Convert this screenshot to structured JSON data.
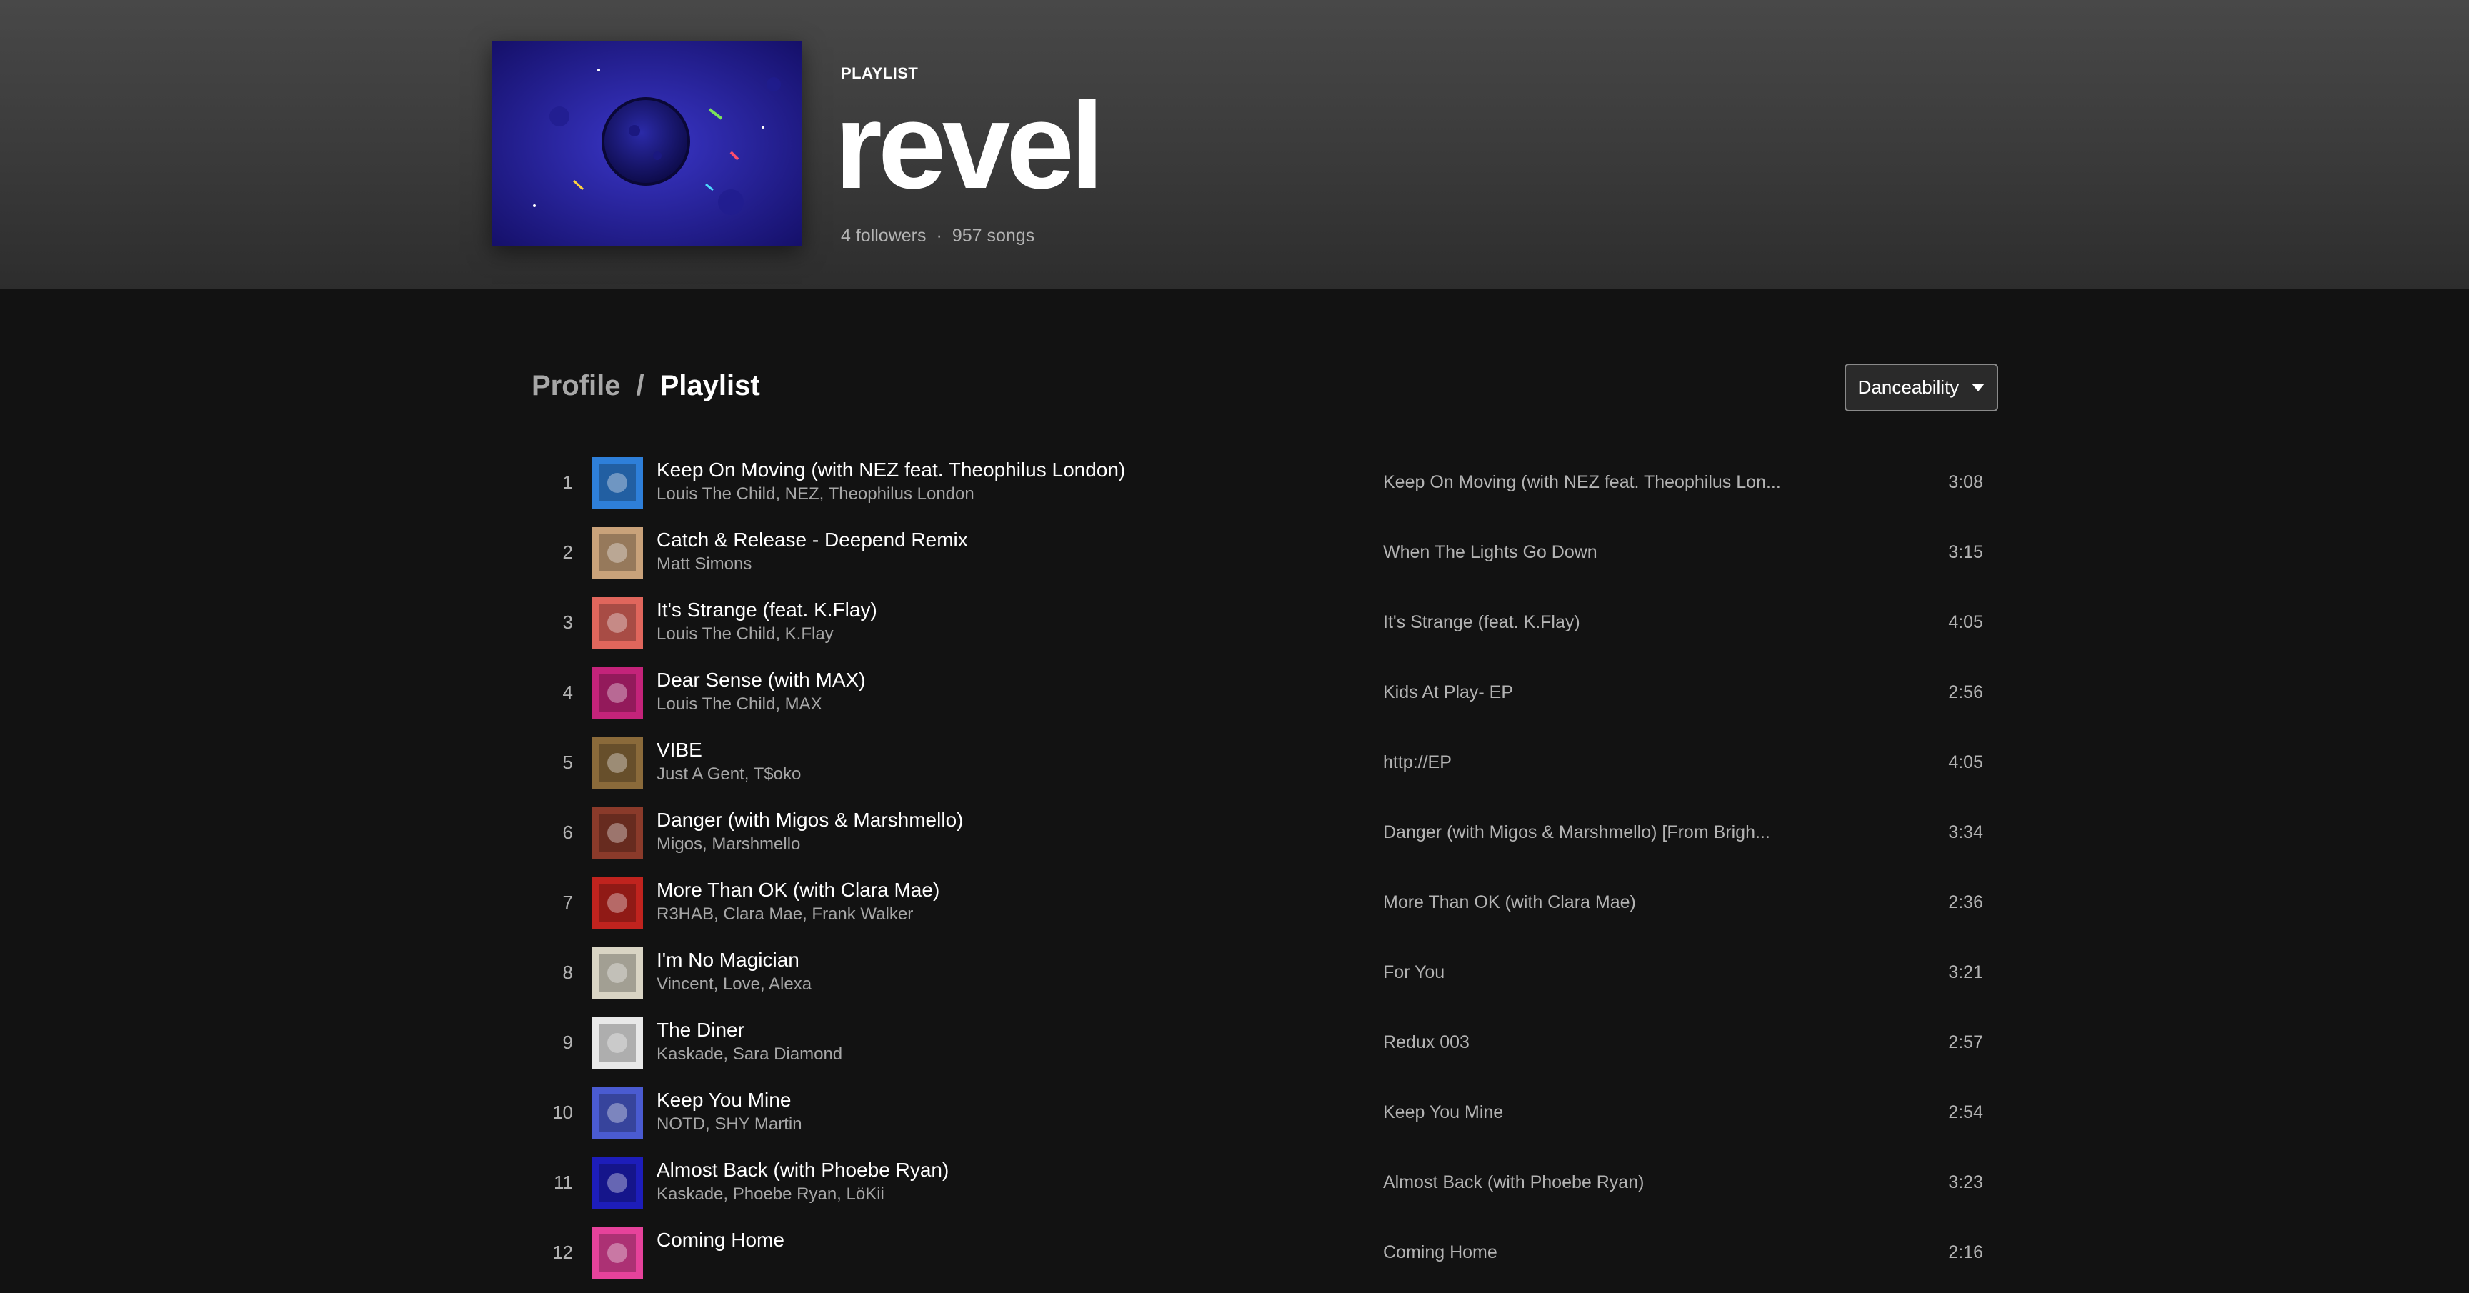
{
  "header": {
    "type_label": "PLAYLIST",
    "title": "revel",
    "followers": "4 followers",
    "separator": "·",
    "songs": "957 songs",
    "cover_icon": "galaxy-planet-artwork"
  },
  "breadcrumb": {
    "profile": "Profile",
    "separator": "/",
    "current": "Playlist"
  },
  "sort": {
    "selected": "Danceability",
    "icon": "caret-down-icon"
  },
  "tracks": [
    {
      "num": "1",
      "title": "Keep On Moving (with NEZ feat. Theophilus London)",
      "artists": "Louis The Child, NEZ, Theophilus London",
      "album": "Keep On Moving (with NEZ feat. Theophilus Lon...",
      "duration": "3:08",
      "art_color": "#2e7fd9"
    },
    {
      "num": "2",
      "title": "Catch & Release - Deepend Remix",
      "artists": "Matt Simons",
      "album": "When The Lights Go Down",
      "duration": "3:15",
      "art_color": "#c9a27a"
    },
    {
      "num": "3",
      "title": "It's Strange (feat. K.Flay)",
      "artists": "Louis The Child, K.Flay",
      "album": "It's Strange (feat. K.Flay)",
      "duration": "4:05",
      "art_color": "#e0665c"
    },
    {
      "num": "4",
      "title": "Dear Sense (with MAX)",
      "artists": "Louis The Child, MAX",
      "album": "Kids At Play- EP",
      "duration": "2:56",
      "art_color": "#c4237a"
    },
    {
      "num": "5",
      "title": "VIBE",
      "artists": "Just A Gent, T$oko",
      "album": "http://EP",
      "duration": "4:05",
      "art_color": "#8a6a3a"
    },
    {
      "num": "6",
      "title": "Danger (with Migos & Marshmello)",
      "artists": "Migos, Marshmello",
      "album": "Danger (with Migos & Marshmello) [From Brigh...",
      "duration": "3:34",
      "art_color": "#8a3a2a"
    },
    {
      "num": "7",
      "title": "More Than OK (with Clara Mae)",
      "artists": "R3HAB, Clara Mae, Frank Walker",
      "album": "More Than OK (with Clara Mae)",
      "duration": "2:36",
      "art_color": "#c0231e"
    },
    {
      "num": "8",
      "title": "I'm No Magician",
      "artists": "Vincent, Love, Alexa",
      "album": "For You",
      "duration": "3:21",
      "art_color": "#d9d4c4"
    },
    {
      "num": "9",
      "title": "The Diner",
      "artists": "Kaskade, Sara Diamond",
      "album": "Redux 003",
      "duration": "2:57",
      "art_color": "#e8e8e8"
    },
    {
      "num": "10",
      "title": "Keep You Mine",
      "artists": "NOTD, SHY Martin",
      "album": "Keep You Mine",
      "duration": "2:54",
      "art_color": "#4a5bd1"
    },
    {
      "num": "11",
      "title": "Almost Back (with Phoebe Ryan)",
      "artists": "Kaskade, Phoebe Ryan, LöKii",
      "album": "Almost Back (with Phoebe Ryan)",
      "duration": "3:23",
      "art_color": "#1d1dba"
    },
    {
      "num": "12",
      "title": "Coming Home",
      "artists": "",
      "album": "Coming Home",
      "duration": "2:16",
      "art_color": "#e6429b"
    }
  ]
}
